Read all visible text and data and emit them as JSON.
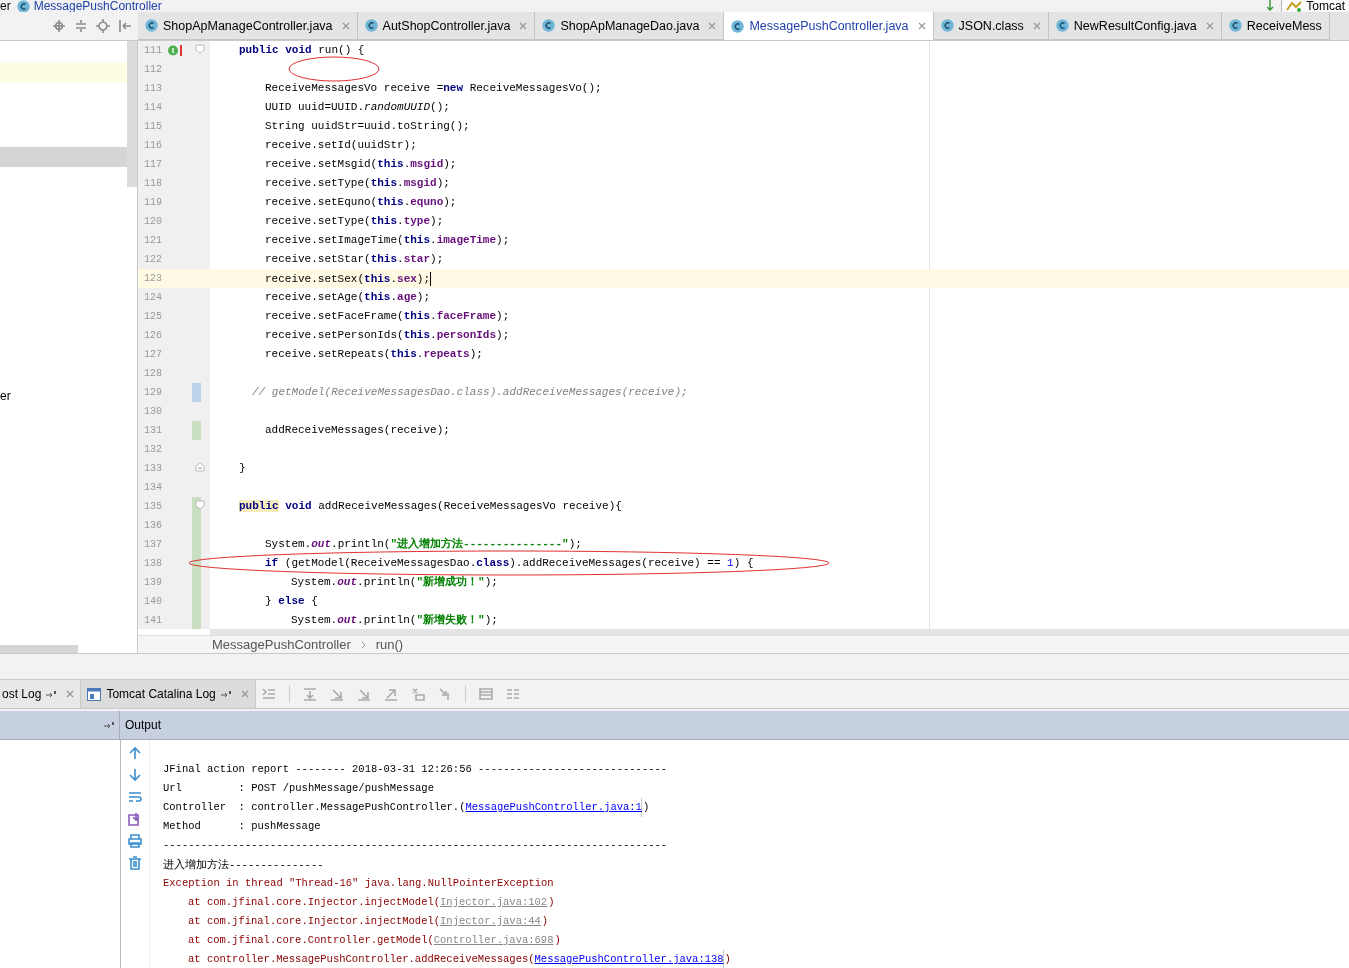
{
  "navbar": {
    "crumbs": [
      {
        "label": "er",
        "icon": false
      },
      {
        "label": "MessagePushController",
        "icon": true
      }
    ],
    "run_config": "Tomcat"
  },
  "editor_tabs": [
    {
      "label": "ShopApManageController.java",
      "selected": false,
      "closable": true
    },
    {
      "label": "AutShopController.java",
      "selected": false,
      "closable": true
    },
    {
      "label": "ShopApManageDao.java",
      "selected": false,
      "closable": true
    },
    {
      "label": "MessagePushController.java",
      "selected": true,
      "closable": true
    },
    {
      "label": "JSON.class",
      "selected": false,
      "closable": true
    },
    {
      "label": "NewResultConfig.java",
      "selected": false,
      "closable": true
    },
    {
      "label": "ReceiveMess",
      "selected": false,
      "closable": false
    }
  ],
  "project_panel": {
    "items": [
      {
        "label": "er"
      }
    ]
  },
  "editor": {
    "lines": [
      {
        "number": "111",
        "current": false,
        "kind": "member",
        "gutter": [
          {
            "kind": "implements"
          },
          {
            "kind": "fold_start"
          }
        ],
        "segments": [
          {
            "kind": "kw",
            "text": "public "
          },
          {
            "kind": "kw",
            "text": "void"
          },
          {
            "kind": "plain",
            "text": " run() {"
          }
        ]
      },
      {
        "number": "112",
        "current": false,
        "kind": "blank"
      },
      {
        "number": "113",
        "current": false,
        "kind": "statement",
        "segments": [
          {
            "kind": "plain",
            "text": "ReceiveMessagesVo receive ="
          },
          {
            "kind": "kw",
            "text": "new"
          },
          {
            "kind": "plain",
            "text": " ReceiveMessagesVo();"
          }
        ]
      },
      {
        "number": "114",
        "current": false,
        "kind": "statement",
        "segments": [
          {
            "kind": "plain",
            "text": "UUID uuid=UUID."
          },
          {
            "kind": "static_method",
            "text": "randomUUID"
          },
          {
            "kind": "plain",
            "text": "();"
          }
        ]
      },
      {
        "number": "115",
        "current": false,
        "kind": "statement",
        "segments": [
          {
            "kind": "plain",
            "text": "String uuidStr=uuid.toString();"
          }
        ]
      },
      {
        "number": "116",
        "current": false,
        "kind": "statement",
        "segments": [
          {
            "kind": "plain",
            "text": "receive.setId(uuidStr);"
          }
        ]
      },
      {
        "number": "117",
        "current": false,
        "kind": "statement",
        "segments": [
          {
            "kind": "plain",
            "text": "receive.setMsgid("
          },
          {
            "kind": "kw",
            "text": "this"
          },
          {
            "kind": "plain",
            "text": "."
          },
          {
            "kind": "field",
            "text": "msgid"
          },
          {
            "kind": "plain",
            "text": ");"
          }
        ]
      },
      {
        "number": "118",
        "current": false,
        "kind": "statement",
        "segments": [
          {
            "kind": "plain",
            "text": "receive.setType("
          },
          {
            "kind": "kw",
            "text": "this"
          },
          {
            "kind": "plain",
            "text": "."
          },
          {
            "kind": "field",
            "text": "msgid"
          },
          {
            "kind": "plain",
            "text": ");"
          }
        ]
      },
      {
        "number": "119",
        "current": false,
        "kind": "statement",
        "segments": [
          {
            "kind": "plain",
            "text": "receive.setEquno("
          },
          {
            "kind": "kw",
            "text": "this"
          },
          {
            "kind": "plain",
            "text": "."
          },
          {
            "kind": "field",
            "text": "equno"
          },
          {
            "kind": "plain",
            "text": ");"
          }
        ]
      },
      {
        "number": "120",
        "current": false,
        "kind": "statement",
        "segments": [
          {
            "kind": "plain",
            "text": "receive.setType("
          },
          {
            "kind": "kw",
            "text": "this"
          },
          {
            "kind": "plain",
            "text": "."
          },
          {
            "kind": "field",
            "text": "type"
          },
          {
            "kind": "plain",
            "text": ");"
          }
        ]
      },
      {
        "number": "121",
        "current": false,
        "kind": "statement",
        "segments": [
          {
            "kind": "plain",
            "text": "receive.setImageTime("
          },
          {
            "kind": "kw",
            "text": "this"
          },
          {
            "kind": "plain",
            "text": "."
          },
          {
            "kind": "field",
            "text": "imageTime"
          },
          {
            "kind": "plain",
            "text": ");"
          }
        ]
      },
      {
        "number": "122",
        "current": false,
        "kind": "statement",
        "segments": [
          {
            "kind": "plain",
            "text": "receive.setStar("
          },
          {
            "kind": "kw",
            "text": "this"
          },
          {
            "kind": "plain",
            "text": "."
          },
          {
            "kind": "field",
            "text": "star"
          },
          {
            "kind": "plain",
            "text": ");"
          }
        ]
      },
      {
        "number": "123",
        "current": true,
        "kind": "statement",
        "segments": [
          {
            "kind": "plain",
            "text": "receive.setSex("
          },
          {
            "kind": "kw",
            "text": "this"
          },
          {
            "kind": "plain",
            "text": "."
          },
          {
            "kind": "field",
            "text": "sex"
          },
          {
            "kind": "plain",
            "text": ");"
          }
        ]
      },
      {
        "number": "124",
        "current": false,
        "kind": "statement",
        "segments": [
          {
            "kind": "plain",
            "text": "receive.setAge("
          },
          {
            "kind": "kw",
            "text": "this"
          },
          {
            "kind": "plain",
            "text": "."
          },
          {
            "kind": "field",
            "text": "age"
          },
          {
            "kind": "plain",
            "text": ");"
          }
        ]
      },
      {
        "number": "125",
        "current": false,
        "kind": "statement",
        "segments": [
          {
            "kind": "plain",
            "text": "receive.setFaceFrame("
          },
          {
            "kind": "kw",
            "text": "this"
          },
          {
            "kind": "plain",
            "text": "."
          },
          {
            "kind": "field",
            "text": "faceFrame"
          },
          {
            "kind": "plain",
            "text": ");"
          }
        ]
      },
      {
        "number": "126",
        "current": false,
        "kind": "statement",
        "segments": [
          {
            "kind": "plain",
            "text": "receive.setPersonIds("
          },
          {
            "kind": "kw",
            "text": "this"
          },
          {
            "kind": "plain",
            "text": "."
          },
          {
            "kind": "field",
            "text": "personIds"
          },
          {
            "kind": "plain",
            "text": ");"
          }
        ]
      },
      {
        "number": "127",
        "current": false,
        "kind": "statement",
        "segments": [
          {
            "kind": "plain",
            "text": "receive.setRepeats("
          },
          {
            "kind": "kw",
            "text": "this"
          },
          {
            "kind": "plain",
            "text": "."
          },
          {
            "kind": "field",
            "text": "repeats"
          },
          {
            "kind": "plain",
            "text": ");"
          }
        ]
      },
      {
        "number": "128",
        "current": false,
        "kind": "blank"
      },
      {
        "number": "129",
        "current": false,
        "kind": "comment",
        "gutter": [
          {
            "kind": "modified"
          }
        ],
        "segments": [
          {
            "kind": "comment",
            "text": "// getModel(ReceiveMessagesDao.class).addReceiveMessages(receive);"
          }
        ]
      },
      {
        "number": "130",
        "current": false,
        "kind": "blank"
      },
      {
        "number": "131",
        "current": false,
        "kind": "statement",
        "gutter": [
          {
            "kind": "added"
          }
        ],
        "segments": [
          {
            "kind": "plain",
            "text": "addReceiveMessages(receive);"
          }
        ]
      },
      {
        "number": "132",
        "current": false,
        "kind": "blank"
      },
      {
        "number": "133",
        "current": false,
        "kind": "member",
        "gutter": [
          {
            "kind": "fold_end"
          }
        ],
        "segments": [
          {
            "kind": "plain",
            "text": "}"
          }
        ]
      },
      {
        "number": "134",
        "current": false,
        "kind": "blank"
      },
      {
        "number": "135",
        "current": false,
        "kind": "member",
        "gutter": [
          {
            "kind": "added"
          },
          {
            "kind": "fold_start"
          }
        ],
        "segments": [
          {
            "kind": "kw_marked",
            "text": "public"
          },
          {
            "kind": "kw",
            "text": " void"
          },
          {
            "kind": "plain",
            "text": " addReceiveMessages(ReceiveMessagesVo receive){"
          }
        ]
      },
      {
        "number": "136",
        "current": false,
        "kind": "blank",
        "gutter": [
          {
            "kind": "added"
          }
        ]
      },
      {
        "number": "137",
        "current": false,
        "kind": "statement",
        "gutter": [
          {
            "kind": "added"
          }
        ],
        "segments": [
          {
            "kind": "plain",
            "text": "System."
          },
          {
            "kind": "static_field",
            "text": "out"
          },
          {
            "kind": "plain",
            "text": ".println("
          },
          {
            "kind": "str",
            "text": "\"进入增加方法---------------\""
          },
          {
            "kind": "plain",
            "text": ");"
          }
        ]
      },
      {
        "number": "138",
        "current": false,
        "kind": "statement",
        "gutter": [
          {
            "kind": "added"
          }
        ],
        "segments": [
          {
            "kind": "kw",
            "text": "if"
          },
          {
            "kind": "plain",
            "text": " (getModel(ReceiveMessagesDao."
          },
          {
            "kind": "kw",
            "text": "class"
          },
          {
            "kind": "plain",
            "text": ").addReceiveMessages(receive) == "
          },
          {
            "kind": "num",
            "text": "1"
          },
          {
            "kind": "plain",
            "text": ") {"
          }
        ]
      },
      {
        "number": "139",
        "current": false,
        "kind": "nested",
        "gutter": [
          {
            "kind": "added"
          }
        ],
        "segments": [
          {
            "kind": "plain",
            "text": "System."
          },
          {
            "kind": "static_field",
            "text": "out"
          },
          {
            "kind": "plain",
            "text": ".println("
          },
          {
            "kind": "str",
            "text": "\"新增成功！\""
          },
          {
            "kind": "plain",
            "text": ");"
          }
        ]
      },
      {
        "number": "140",
        "current": false,
        "kind": "statement",
        "gutter": [
          {
            "kind": "added"
          }
        ],
        "segments": [
          {
            "kind": "plain",
            "text": "} "
          },
          {
            "kind": "kw",
            "text": "else"
          },
          {
            "kind": "plain",
            "text": " {"
          }
        ]
      },
      {
        "number": "141",
        "current": false,
        "kind": "nested",
        "gutter": [
          {
            "kind": "added"
          }
        ],
        "segments": [
          {
            "kind": "plain",
            "text": "System."
          },
          {
            "kind": "static_field",
            "text": "out"
          },
          {
            "kind": "plain",
            "text": ".println("
          },
          {
            "kind": "str",
            "text": "\"新增失败！\""
          },
          {
            "kind": "plain",
            "text": ");"
          }
        ]
      }
    ],
    "breadcrumbs": [
      "MessagePushController",
      "run()"
    ]
  },
  "tool_tabs": [
    {
      "label": "ost Log",
      "selected": false
    },
    {
      "label": "Tomcat Catalina Log",
      "selected": true
    }
  ],
  "output": {
    "title": "Output",
    "lines": [
      {
        "kind": "plain",
        "text": "JFinal action report -------- 2018-03-31 12:26:56 ------------------------------"
      },
      {
        "kind": "plain",
        "text": "Url         : POST /pushMessage/pushMessage"
      },
      {
        "kind": "plain",
        "text": "Controller  : controller.MessagePushController.(",
        "link": {
          "text": "MessagePushController.java:1",
          "kind": "project"
        },
        "tail": ")"
      },
      {
        "kind": "plain",
        "text": "Method      : pushMessage"
      },
      {
        "kind": "plain",
        "text": "--------------------------------------------------------------------------------"
      },
      {
        "kind": "stdout",
        "text": "进入增加方法---------------"
      },
      {
        "kind": "error",
        "text": "Exception in thread \"Thread-16\" java.lang.NullPointerException"
      },
      {
        "kind": "trace",
        "text": "at com.jfinal.core.Injector.injectModel(",
        "link": {
          "text": "Injector.java:102",
          "kind": "library"
        },
        "tail": ")"
      },
      {
        "kind": "trace",
        "text": "at com.jfinal.core.Injector.injectModel(",
        "link": {
          "text": "Injector.java:44",
          "kind": "library"
        },
        "tail": ")"
      },
      {
        "kind": "trace",
        "text": "at com.jfinal.core.Controller.getModel(",
        "link": {
          "text": "Controller.java:698",
          "kind": "library"
        },
        "tail": ")"
      },
      {
        "kind": "trace",
        "text": "at controller.MessagePushController.addReceiveMessages(",
        "link": {
          "text": "MessagePushController.java:138",
          "kind": "project"
        },
        "tail": ")"
      }
    ]
  }
}
